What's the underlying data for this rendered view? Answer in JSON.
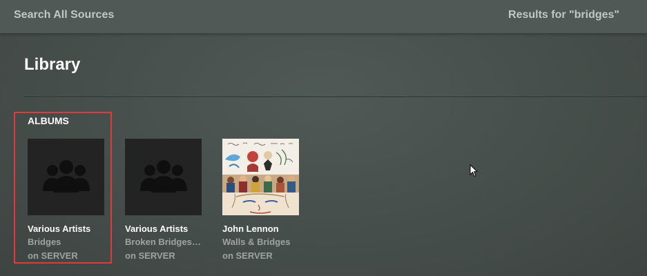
{
  "header": {
    "search_label": "Search All Sources",
    "results_label": "Results for \"bridges\""
  },
  "library": {
    "title": "Library",
    "section_title": "ALBUMS",
    "albums": [
      {
        "artist": "Various Artists",
        "title": "Bridges",
        "source": "on SERVER",
        "cover": "artist-group-placeholder-icon",
        "selected": true
      },
      {
        "artist": "Various Artists",
        "title": "Broken Bridges:...",
        "source": "on SERVER",
        "cover": "artist-group-placeholder-icon",
        "selected": false
      },
      {
        "artist": "John Lennon",
        "title": "Walls & Bridges",
        "source": "on SERVER",
        "cover": "album-art-collage",
        "selected": false
      }
    ]
  },
  "colors": {
    "background": "#4a5350",
    "highlight": "#e23a36",
    "muted_text": "#9ea3a1"
  }
}
